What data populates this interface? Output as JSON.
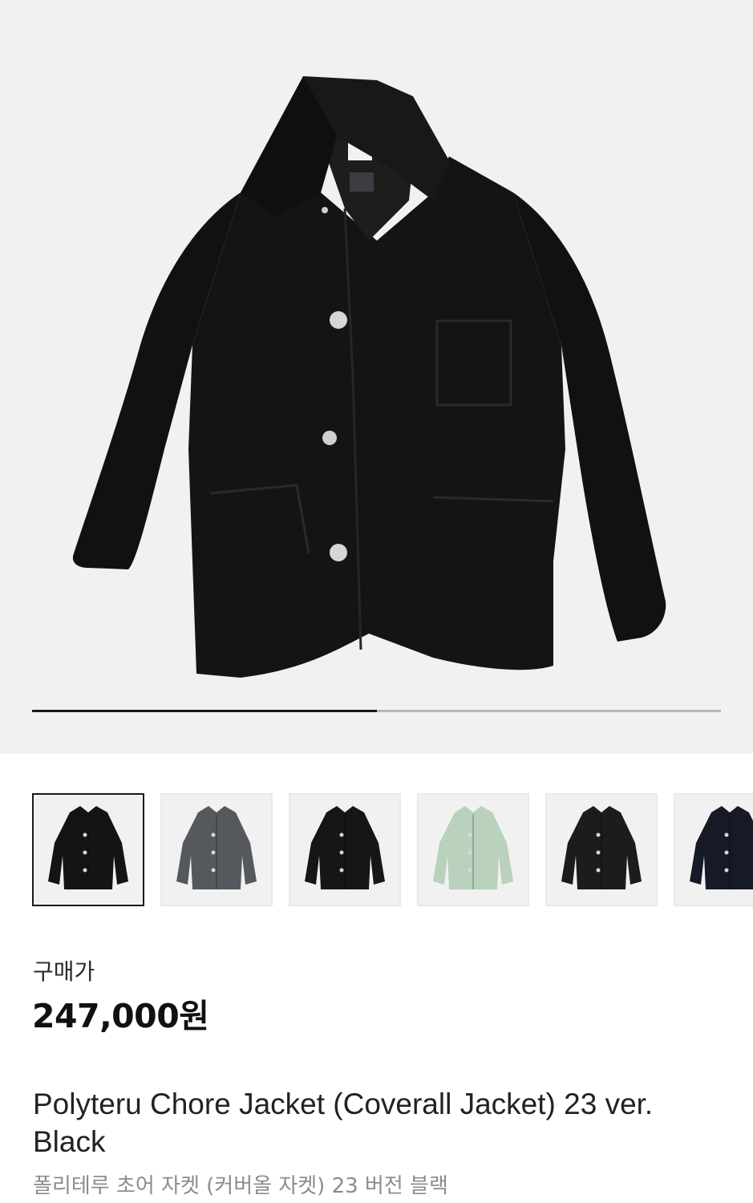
{
  "gallery": {
    "main_image": "black-chore-jacket-photo",
    "carousel_position": 0.5
  },
  "thumbnails": [
    {
      "name": "black-jacket",
      "color": "#141414",
      "selected": true
    },
    {
      "name": "charcoal-jacket",
      "color": "#55585d",
      "selected": false
    },
    {
      "name": "black-jacket-alt",
      "color": "#161616",
      "selected": false
    },
    {
      "name": "mint-jacket",
      "color": "#b9d1bd",
      "selected": false
    },
    {
      "name": "black-jacket-dark",
      "color": "#1c1c1c",
      "selected": false
    },
    {
      "name": "navy-jacket",
      "color": "#161a26",
      "selected": false
    }
  ],
  "product": {
    "price_label": "구매가",
    "price": "247,000원",
    "title": "Polyteru Chore Jacket (Coverall Jacket) 23 ver. Black",
    "subtitle": "폴리테루 초어 자켓 (커버올 자켓) 23 버전 블랙"
  }
}
